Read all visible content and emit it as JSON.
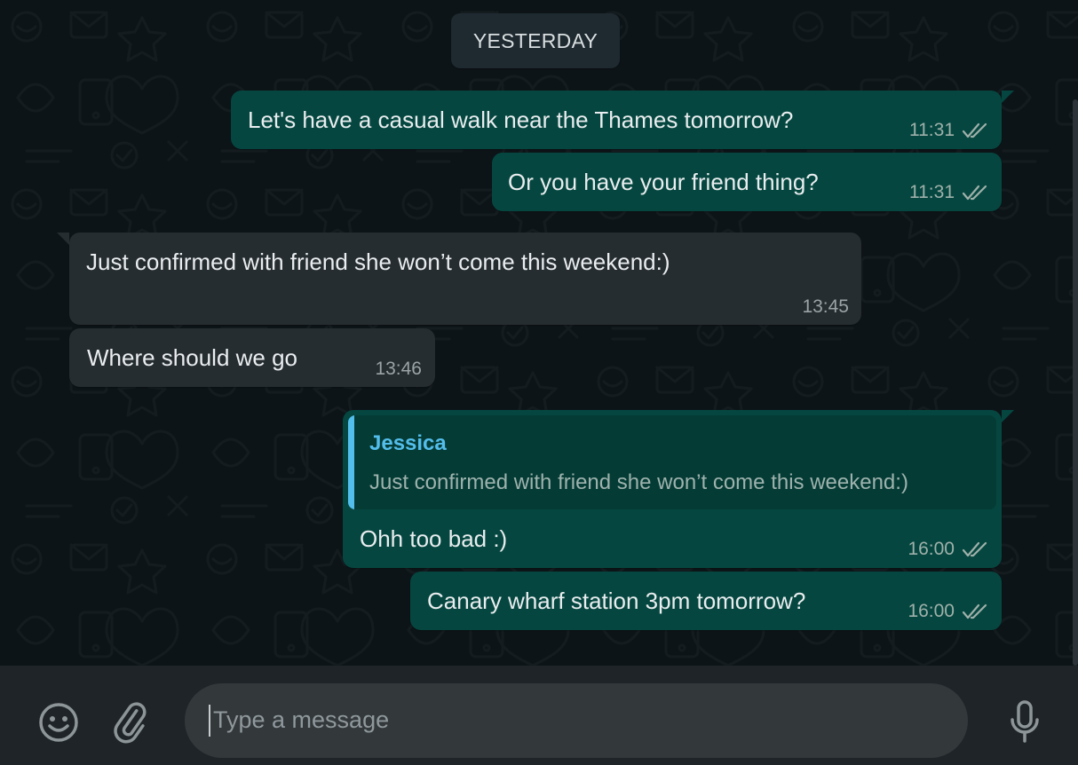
{
  "date_divider": "YESTERDAY",
  "messages": [
    {
      "direction": "out",
      "text": "Let's have a casual walk near the Thames tomorrow?",
      "time": "11:31",
      "status": "read"
    },
    {
      "direction": "out",
      "text": "Or you have your friend thing?",
      "time": "11:31",
      "status": "read"
    },
    {
      "direction": "in",
      "text": "Just confirmed with friend she won’t come this weekend:)",
      "time": "13:45"
    },
    {
      "direction": "in",
      "text": "Where should we go",
      "time": "13:46"
    },
    {
      "direction": "out",
      "text": "Ohh too bad :)",
      "time": "16:00",
      "status": "read",
      "quoted": {
        "author": "Jessica",
        "text": "Just confirmed with friend she won’t come this weekend:)"
      }
    },
    {
      "direction": "out",
      "text": "Canary wharf station 3pm tomorrow?",
      "time": "16:00",
      "status": "read"
    }
  ],
  "composer": {
    "placeholder": "Type a message",
    "emoji_icon": "emoji-icon",
    "attach_icon": "paperclip-icon",
    "mic_icon": "microphone-icon"
  },
  "colors": {
    "outgoing_bubble": "#054740",
    "incoming_bubble": "#262d31",
    "background": "#0d1418",
    "read_tick": "#9fb0aa",
    "quote_accent": "#53bdeb"
  }
}
